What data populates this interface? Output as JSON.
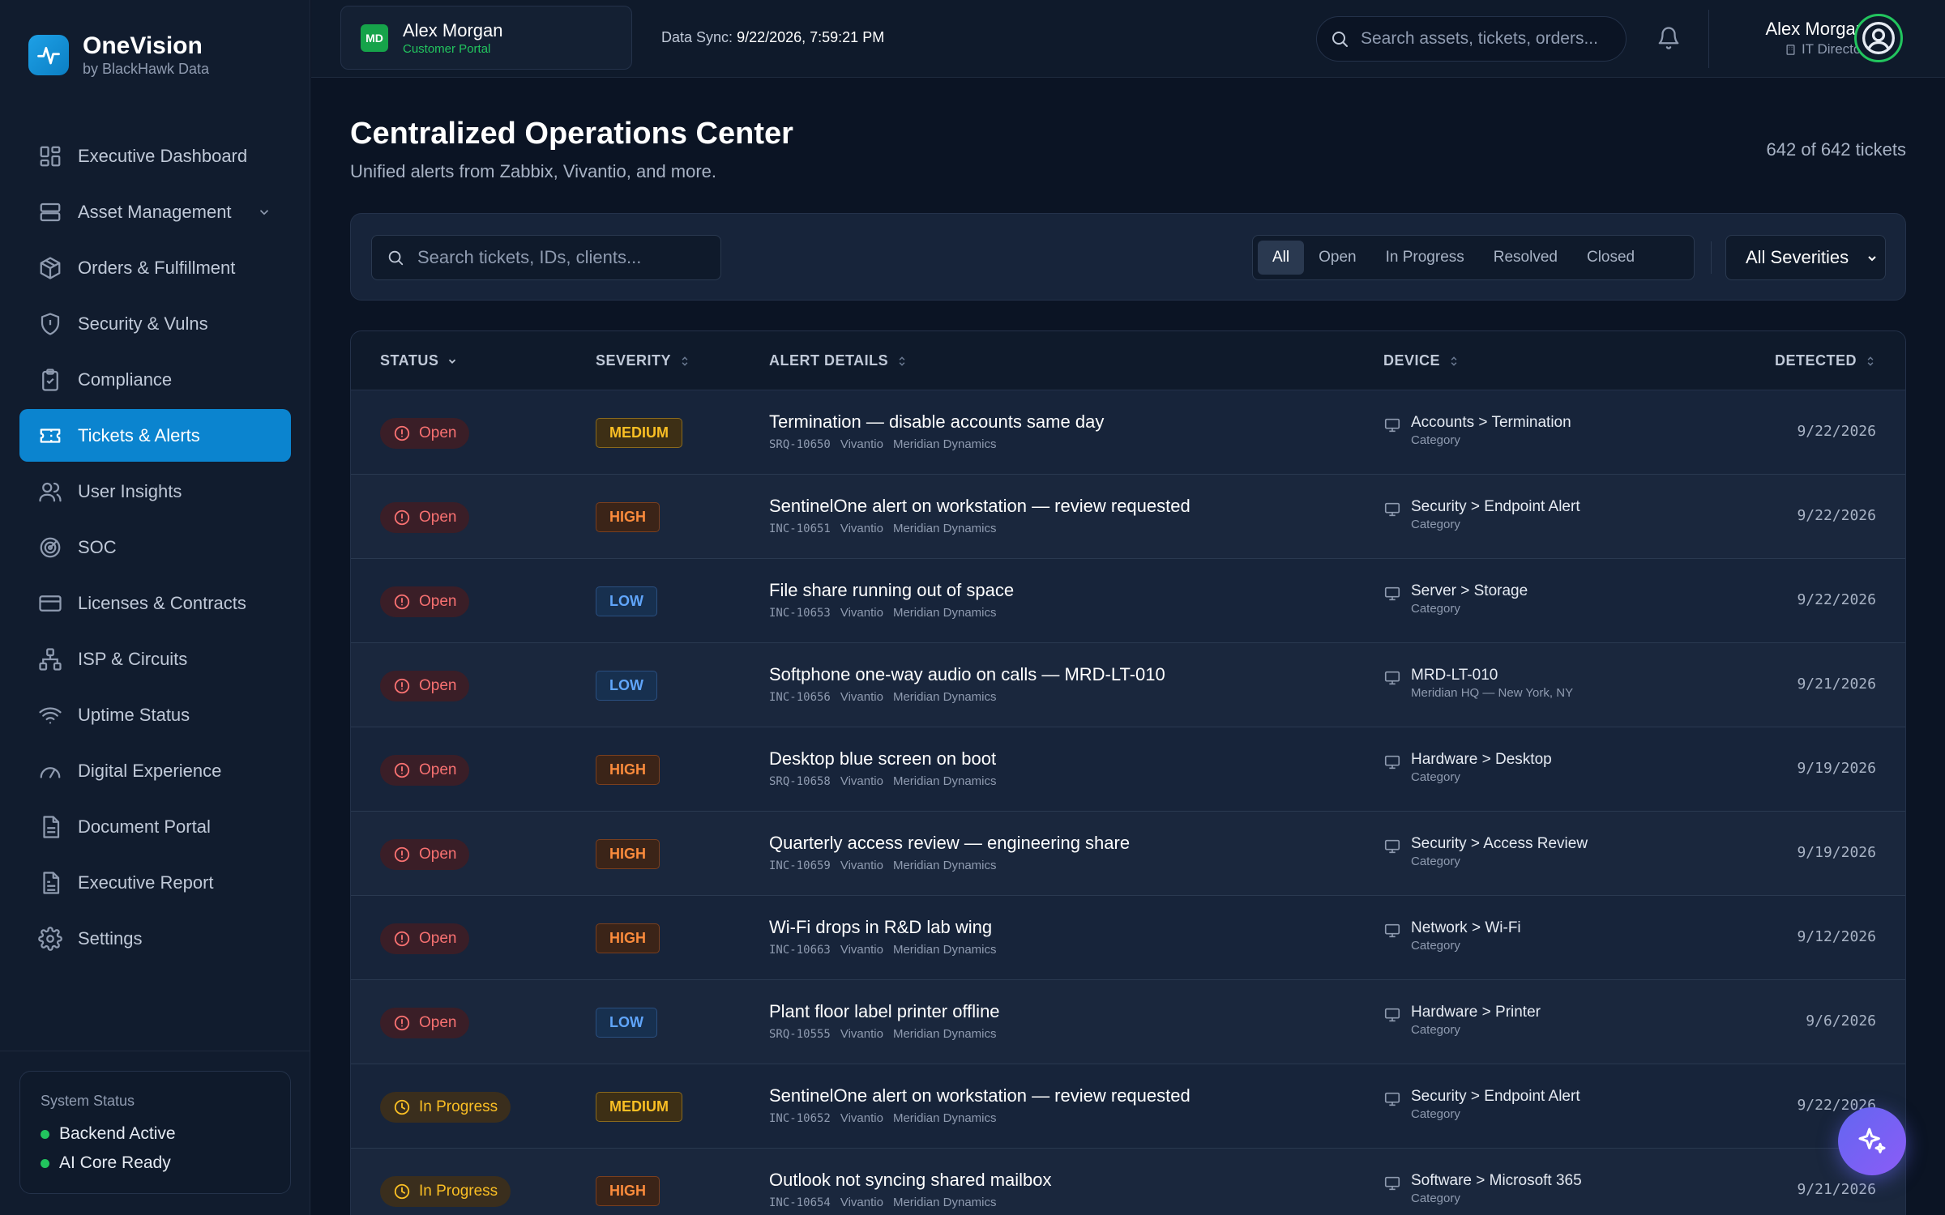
{
  "brand": {
    "name": "OneVision",
    "sub": "by BlackHawk Data"
  },
  "nav": [
    {
      "label": "Executive Dashboard",
      "icon": "dashboard-icon"
    },
    {
      "label": "Asset Management",
      "icon": "server-icon"
    },
    {
      "label": "Orders & Fulfillment",
      "icon": "package-icon"
    },
    {
      "label": "Security & Vulns",
      "icon": "shield-icon"
    },
    {
      "label": "Compliance",
      "icon": "clipboard-check-icon"
    },
    {
      "label": "Tickets & Alerts",
      "icon": "ticket-icon"
    },
    {
      "label": "User Insights",
      "icon": "users-icon"
    },
    {
      "label": "SOC",
      "icon": "radar-icon"
    },
    {
      "label": "Licenses & Contracts",
      "icon": "credit-card-icon"
    },
    {
      "label": "ISP & Circuits",
      "icon": "network-icon"
    },
    {
      "label": "Uptime Status",
      "icon": "wifi-icon"
    },
    {
      "label": "Digital Experience",
      "icon": "gauge-icon"
    },
    {
      "label": "Document Portal",
      "icon": "document-icon"
    },
    {
      "label": "Executive Report",
      "icon": "report-icon"
    },
    {
      "label": "Settings",
      "icon": "gear-icon"
    }
  ],
  "system_status": {
    "title": "System Status",
    "items": [
      "Backend Active",
      "AI Core Ready"
    ]
  },
  "header": {
    "client_initials": "MD",
    "client_name": "Alex Morgan",
    "client_role": "Customer Portal",
    "sync_label": "Data Sync:",
    "sync_value": "9/22/2026, 7:59:21 PM",
    "search_placeholder": "Search assets, tickets, orders...",
    "user_name": "Alex Morgan",
    "user_role": "IT Director"
  },
  "page": {
    "title": "Centralized Operations Center",
    "subtitle": "Unified alerts from Zabbix, Vivantio, and more.",
    "count": "642 of 642 tickets"
  },
  "filters": {
    "search_placeholder": "Search tickets, IDs, clients...",
    "segments": [
      "All",
      "Open",
      "In Progress",
      "Resolved",
      "Closed"
    ],
    "active_segment": "All",
    "severity": "All Severities"
  },
  "table": {
    "headers": {
      "status": "STATUS",
      "severity": "SEVERITY",
      "alert": "ALERT DETAILS",
      "device": "DEVICE",
      "detected": "DETECTED"
    },
    "rows": [
      {
        "status": "Open",
        "severity": "MEDIUM",
        "title": "Termination — disable accounts same day",
        "id": "SRQ-10650",
        "source": "Vivantio",
        "client": "Meridian Dynamics",
        "device": "Accounts > Termination",
        "device_sub": "Category",
        "detected": "9/22/2026"
      },
      {
        "status": "Open",
        "severity": "HIGH",
        "title": "SentinelOne alert on workstation — review requested",
        "id": "INC-10651",
        "source": "Vivantio",
        "client": "Meridian Dynamics",
        "device": "Security > Endpoint Alert",
        "device_sub": "Category",
        "detected": "9/22/2026"
      },
      {
        "status": "Open",
        "severity": "LOW",
        "title": "File share running out of space",
        "id": "INC-10653",
        "source": "Vivantio",
        "client": "Meridian Dynamics",
        "device": "Server > Storage",
        "device_sub": "Category",
        "detected": "9/22/2026"
      },
      {
        "status": "Open",
        "severity": "LOW",
        "title": "Softphone one-way audio on calls — MRD-LT-010",
        "id": "INC-10656",
        "source": "Vivantio",
        "client": "Meridian Dynamics",
        "device": "MRD-LT-010",
        "device_sub": "Meridian HQ — New York, NY",
        "detected": "9/21/2026"
      },
      {
        "status": "Open",
        "severity": "HIGH",
        "title": "Desktop blue screen on boot",
        "id": "SRQ-10658",
        "source": "Vivantio",
        "client": "Meridian Dynamics",
        "device": "Hardware > Desktop",
        "device_sub": "Category",
        "detected": "9/19/2026"
      },
      {
        "status": "Open",
        "severity": "HIGH",
        "title": "Quarterly access review — engineering share",
        "id": "INC-10659",
        "source": "Vivantio",
        "client": "Meridian Dynamics",
        "device": "Security > Access Review",
        "device_sub": "Category",
        "detected": "9/19/2026"
      },
      {
        "status": "Open",
        "severity": "HIGH",
        "title": "Wi-Fi drops in R&D lab wing",
        "id": "INC-10663",
        "source": "Vivantio",
        "client": "Meridian Dynamics",
        "device": "Network > Wi-Fi",
        "device_sub": "Category",
        "detected": "9/12/2026"
      },
      {
        "status": "Open",
        "severity": "LOW",
        "title": "Plant floor label printer offline",
        "id": "SRQ-10555",
        "source": "Vivantio",
        "client": "Meridian Dynamics",
        "device": "Hardware > Printer",
        "device_sub": "Category",
        "detected": "9/6/2026"
      },
      {
        "status": "In Progress",
        "severity": "MEDIUM",
        "title": "SentinelOne alert on workstation — review requested",
        "id": "INC-10652",
        "source": "Vivantio",
        "client": "Meridian Dynamics",
        "device": "Security > Endpoint Alert",
        "device_sub": "Category",
        "detected": "9/22/2026"
      },
      {
        "status": "In Progress",
        "severity": "HIGH",
        "title": "Outlook not syncing shared mailbox",
        "id": "INC-10654",
        "source": "Vivantio",
        "client": "Meridian Dynamics",
        "device": "Software > Microsoft 365",
        "device_sub": "Category",
        "detected": "9/21/2026"
      }
    ]
  },
  "colors": {
    "accent": "#0b84cf",
    "open": "#f87171",
    "progress": "#fbbf24",
    "ok": "#22c55e"
  }
}
